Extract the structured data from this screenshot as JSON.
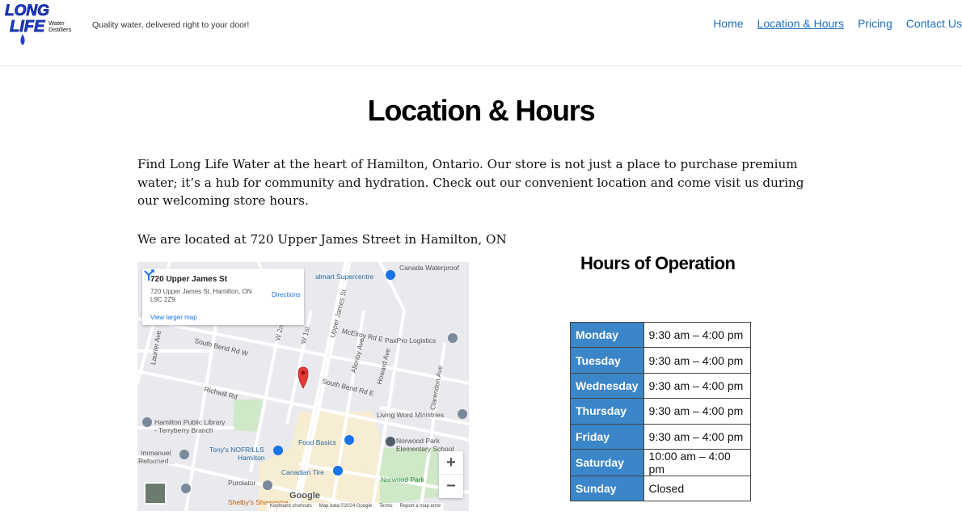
{
  "header": {
    "logo_text": "Long Life Water Distillers",
    "tagline": "Quality water, delivered right to your door!",
    "nav": [
      {
        "label": "Home",
        "current": false
      },
      {
        "label": "Location & Hours",
        "current": true
      },
      {
        "label": "Pricing",
        "current": false
      },
      {
        "label": "Contact Us",
        "current": false
      }
    ]
  },
  "main": {
    "title": "Location & Hours",
    "intro": "Find Long Life Water at the heart of Hamilton, Ontario. Our store is not just a place to purchase premium water; it’s a hub for community and hydration. Check out our convenient location and come visit us during our welcoming store hours.",
    "located": "We are located at 720 Upper James Street in Hamilton, ON"
  },
  "map": {
    "card_title": "720 Upper James St",
    "card_address": "720 Upper James St, Hamilton, ON L9C 2Z9",
    "directions_label": "Directions",
    "larger_map_label": "View larger map",
    "zoom_in": "+",
    "zoom_out": "−",
    "google": "Google",
    "footer": [
      "Keyboard shortcuts",
      "Map data ©2024 Google",
      "Terms",
      "Report a map error"
    ],
    "labels": {
      "canada_waterproof": "Canada Waterproof",
      "walmart": "almart Supercentre",
      "south_bend_w": "South Bend Rd W",
      "south_bend_e": "South Bend Rd E",
      "richwill": "Richwill Rd",
      "mcelroy": "McElroy Rd E",
      "paxpro": "PaxPro Logistics",
      "upper_james": "Upper James St",
      "allenby": "Allenby Ave",
      "howard": "Howard Ave",
      "clarendon": "Clarendon Ave",
      "laurier": "Laurier Ave",
      "living_word": "Living Word Ministries",
      "library_1": "Hamilton Public Library",
      "library_2": "- Terryberry Branch",
      "food_basics": "Food Basics",
      "norwood_school_1": "Norwood Park",
      "norwood_school_2": "Elementary School",
      "immanuel_1": "Immanuel",
      "immanuel_2": "Reformed...",
      "nofrills_1": "Tony's NOFRILLS",
      "nofrills_2": "Hamilton",
      "canadian_tire": "Canadian Tire",
      "norwood_park": "Norwood Park",
      "purolator": "Purolator",
      "shelbys": "Shelby's Shawarma",
      "w_2nd": "W 2n",
      "w_1st": "W 1st"
    }
  },
  "hours": {
    "title": "Hours of Operation",
    "rows": [
      {
        "day": "Monday",
        "time": "9:30 am – 4:00 pm"
      },
      {
        "day": "Tuesday",
        "time": "9:30 am – 4:00 pm"
      },
      {
        "day": "Wednesday",
        "time": "9:30 am – 4:00 pm"
      },
      {
        "day": "Thursday",
        "time": "9:30 am – 4:00 pm"
      },
      {
        "day": "Friday",
        "time": "9:30 am – 4:00 pm"
      },
      {
        "day": "Saturday",
        "time": "10:00 am – 4:00 pm"
      },
      {
        "day": "Sunday",
        "time": "Closed"
      }
    ]
  },
  "colors": {
    "nav_link": "#1e6fbf",
    "hours_day_bg": "#3a86c8",
    "logo_blue": "#1c3fd6",
    "map_pin": "#e53935"
  }
}
